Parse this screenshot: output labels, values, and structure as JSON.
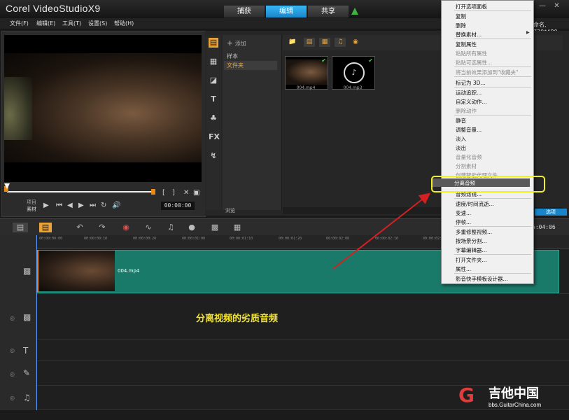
{
  "app": {
    "title": "Corel VideoStudioX9"
  },
  "top_tabs": [
    {
      "label": "捕获"
    },
    {
      "label": "编辑"
    },
    {
      "label": "共享"
    }
  ],
  "menu": {
    "file": "文件(F)",
    "edit": "编辑(E)",
    "tools": "工具(T)",
    "settings": "设置(S)",
    "help": "帮助(H)"
  },
  "right_info": "命名, 720*480",
  "player": {
    "project_label": "项目",
    "clip_label": "素材",
    "timecode": "00:00:00",
    "bracket_in": "[",
    "bracket_out": "]"
  },
  "library": {
    "add_label": "添加",
    "folders": [
      "样本",
      "文件夹"
    ],
    "browse_label": "浏览",
    "items": [
      {
        "name": "004.mp4"
      },
      {
        "name": "004.mp3"
      }
    ],
    "options_label": "选项"
  },
  "timeline": {
    "time_readout": "5:04:06",
    "ruler_ticks": [
      "00:00:00:00",
      "00:00:00:10",
      "00:00:00:20",
      "00:00:01:00",
      "00:00:01:10",
      "00:00:01:20",
      "00:00:02:00",
      "00:00:02:10",
      "00:00:02:20"
    ],
    "clip_name": "004.mp4",
    "caption": "分离视频的劣质音频"
  },
  "context_menu": {
    "items": [
      {
        "label": "打开选项面板",
        "disabled": false
      },
      {
        "label": "复制",
        "disabled": false
      },
      {
        "label": "删除",
        "disabled": false
      },
      {
        "label": "替换素材...",
        "disabled": false
      },
      {
        "label": "复制属性",
        "disabled": false
      },
      {
        "label": "粘贴所有属性",
        "disabled": true
      },
      {
        "label": "粘贴可选属性...",
        "disabled": true
      },
      {
        "label": "将当前效果添加到\"收藏夹\"",
        "disabled": true
      },
      {
        "label": "标记为 3D...",
        "disabled": false
      },
      {
        "label": "运动追踪...",
        "disabled": false
      },
      {
        "label": "自定义动作...",
        "disabled": false
      },
      {
        "label": "删除动作",
        "disabled": true
      },
      {
        "label": "静音",
        "disabled": false
      },
      {
        "label": "调整音量...",
        "disabled": false
      },
      {
        "label": "淡入",
        "disabled": false
      },
      {
        "label": "淡出",
        "disabled": false
      },
      {
        "label": "音量化音频",
        "disabled": true
      },
      {
        "label": "分割素材",
        "disabled": true
      },
      {
        "label": "创建智能代理文件",
        "disabled": true
      },
      {
        "label": "分离音频",
        "disabled": false
      },
      {
        "label": "音频滤镜...",
        "disabled": false
      },
      {
        "label": "速度/时间流逝...",
        "disabled": false
      },
      {
        "label": "变速...",
        "disabled": false
      },
      {
        "label": "停帧...",
        "disabled": false
      },
      {
        "label": "多重修整视频...",
        "disabled": false
      },
      {
        "label": "按场景分割...",
        "disabled": false
      },
      {
        "label": "字幕编辑器...",
        "disabled": false
      },
      {
        "label": "打开文件夹...",
        "disabled": false
      },
      {
        "label": "属性...",
        "disabled": false
      },
      {
        "label": "影音快手模板设计器...",
        "disabled": false
      }
    ],
    "highlighted": "分离音频"
  },
  "watermark": {
    "title": "吉他中国",
    "url": "bbs.GuitarChina.com"
  }
}
